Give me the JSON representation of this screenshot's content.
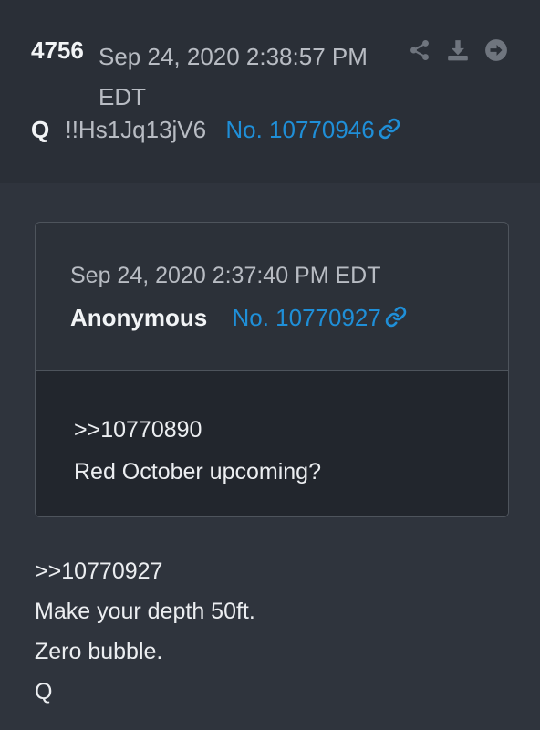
{
  "post": {
    "number": "4756",
    "date": "Sep 24, 2020 2:38:57 PM EDT",
    "author": "Q",
    "tripcode": "!!Hs1Jq13jV6",
    "post_id": "No. 10770946"
  },
  "icons": {
    "share": "share-icon",
    "download": "download-icon",
    "navigate": "arrow-right-circle-icon",
    "link": "link-icon"
  },
  "quoted": {
    "date": "Sep 24, 2020 2:37:40 PM EDT",
    "author": "Anonymous",
    "post_id": "No. 10770927",
    "body": [
      ">>10770890",
      "Red October upcoming?"
    ]
  },
  "body": [
    ">>10770927",
    "Make your depth 50ft.",
    "Zero bubble.",
    "Q"
  ],
  "colors": {
    "background": "#2f343d",
    "header_background": "#2a2f37",
    "quote_body_background": "#22262d",
    "link": "#1f8fd8",
    "muted_text": "#b8bcc3",
    "text": "#eceef1"
  }
}
